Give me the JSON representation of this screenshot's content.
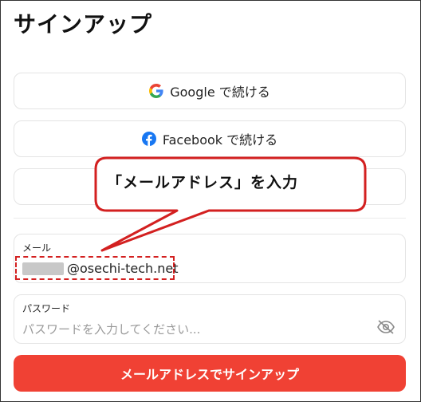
{
  "page": {
    "title": "サインアップ"
  },
  "oauth": {
    "google_label": "Google で続ける",
    "facebook_label": "Facebook で続ける"
  },
  "email": {
    "label": "メール",
    "value_suffix": "@osechi-tech.net"
  },
  "password": {
    "label": "パスワード",
    "placeholder": "パスワードを入力してください..."
  },
  "submit_label": "メールアドレスでサインアップ",
  "callout": {
    "text": "「メールアドレス」を入力"
  },
  "colors": {
    "accent": "#f04134",
    "callout_border": "#d32020",
    "google_blue": "#4285F4",
    "google_red": "#EA4335",
    "google_yellow": "#FBBC05",
    "google_green": "#34A853",
    "facebook_blue": "#1877F2"
  },
  "icons": [
    "google-icon",
    "facebook-icon",
    "eye-off-icon"
  ]
}
